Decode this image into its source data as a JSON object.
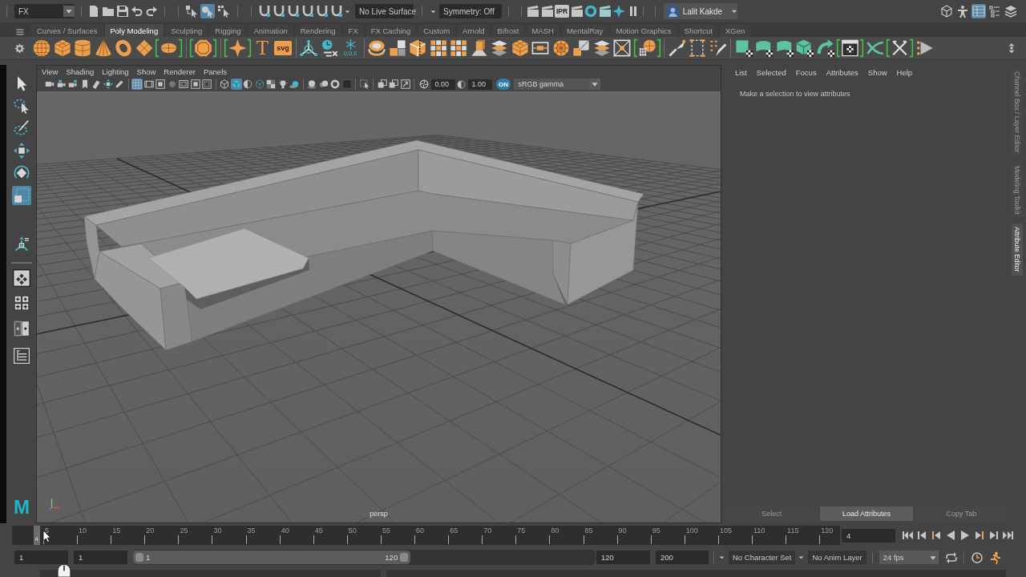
{
  "status_line": {
    "menu_set": "FX",
    "selection_modes": [
      {
        "selected": false
      },
      {
        "selected": true
      },
      {
        "selected": false
      }
    ],
    "live_surface": "No Live Surface",
    "symmetry": "Symmetry: Off",
    "ipr_label": "IPR",
    "user": "Lalit Kakde",
    "panel_toggles": [
      {
        "selected": false
      },
      {
        "selected": false
      },
      {
        "selected": true
      },
      {
        "selected": false
      },
      {
        "selected": false
      }
    ]
  },
  "shelf": {
    "tabs": [
      {
        "label": "Curves / Surfaces",
        "selected": false
      },
      {
        "label": "Poly Modeling",
        "selected": true
      },
      {
        "label": "Sculpting",
        "selected": false
      },
      {
        "label": "Rigging",
        "selected": false
      },
      {
        "label": "Animation",
        "selected": false
      },
      {
        "label": "Rendering",
        "selected": false
      },
      {
        "label": "FX",
        "selected": false
      },
      {
        "label": "FX Caching",
        "selected": false
      },
      {
        "label": "Custom",
        "selected": false
      },
      {
        "label": "Arnold",
        "selected": false
      },
      {
        "label": "Bifrost",
        "selected": false
      },
      {
        "label": "MASH",
        "selected": false
      },
      {
        "label": "MentalRay",
        "selected": false
      },
      {
        "label": "Motion Graphics",
        "selected": false
      },
      {
        "label": "Shortcut",
        "selected": false
      },
      {
        "label": "XGen",
        "selected": false
      }
    ],
    "text_glyph": "T",
    "svg_label": "svg",
    "freeze_label": "0,0,0"
  },
  "toolbox": {
    "tools": [
      {
        "selected": false
      },
      {
        "selected": false
      },
      {
        "selected": false
      },
      {
        "selected": false
      },
      {
        "selected": false
      },
      {
        "selected": true
      },
      {
        "selected": false
      }
    ],
    "logo": "M"
  },
  "viewport": {
    "menus": [
      "View",
      "Shading",
      "Lighting",
      "Show",
      "Renderer",
      "Panels"
    ],
    "toggles": [
      {
        "selected": false
      },
      {
        "selected": false
      },
      {
        "selected": false
      },
      {
        "selected": false
      },
      {
        "selected": false
      },
      {
        "selected": false
      },
      {
        "selected": false
      },
      {
        "selected": true
      },
      {
        "selected": false
      },
      {
        "selected": false
      },
      {
        "selected": false
      },
      {
        "selected": false
      },
      {
        "selected": false
      },
      {
        "selected": false
      },
      {
        "selected": false
      },
      {
        "selected": true
      },
      {
        "selected": false
      },
      {
        "selected": false
      },
      {
        "selected": false
      },
      {
        "selected": false
      },
      {
        "selected": false
      },
      {
        "selected": false
      },
      {
        "selected": false
      },
      {
        "selected": false
      },
      {
        "selected": false
      },
      {
        "selected": false
      },
      {
        "selected": false
      },
      {
        "selected": false
      },
      {
        "selected": false
      }
    ],
    "exposure": "0.00",
    "gamma": "1.00",
    "color_management": "ON",
    "view_transform": "sRGB gamma",
    "camera": "persp"
  },
  "attribute_editor": {
    "menus": [
      "List",
      "Selected",
      "Focus",
      "Attributes",
      "Show",
      "Help"
    ],
    "message": "Make a selection to view attributes",
    "buttons": [
      {
        "label": "Select",
        "disabled": true
      },
      {
        "label": "Load Attributes",
        "disabled": false
      },
      {
        "label": "Copy Tab",
        "disabled": true
      }
    ]
  },
  "side_tabs": [
    {
      "label": "Channel Box / Layer Editor",
      "selected": false
    },
    {
      "label": "Modeling Toolkit",
      "selected": false
    },
    {
      "label": "Attribute Editor",
      "selected": true
    }
  ],
  "time_slider": {
    "ticks": [
      "5",
      "10",
      "15",
      "20",
      "25",
      "30",
      "35",
      "40",
      "45",
      "50",
      "55",
      "60",
      "65",
      "70",
      "75",
      "80",
      "85",
      "90",
      "95",
      "100",
      "105",
      "110",
      "115",
      "120"
    ],
    "level": 0.025,
    "playhead_label": "4",
    "current_frame": "4"
  },
  "range_slider": {
    "animation_start": "1",
    "playback_start": "1",
    "level": 0.6,
    "range_start": "1",
    "range_end": "120",
    "playback_end": "120",
    "animation_end": "200",
    "character_set": "No Character Set",
    "anim_layer": "No Anim Layer",
    "fps": "24 fps"
  }
}
